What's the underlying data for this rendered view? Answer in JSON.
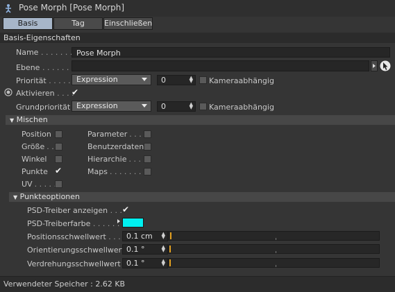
{
  "window": {
    "title": "Pose Morph [Pose Morph]"
  },
  "tabs": [
    {
      "label": "Basis",
      "active": true
    },
    {
      "label": "Tag",
      "active": false
    },
    {
      "label": "Einschließen",
      "active": false
    }
  ],
  "basis": {
    "header": "Basis-Eigenschaften",
    "name_label": "Name",
    "name_dots": ". . . . . . .",
    "name_value": "Pose Morph",
    "ebene_label": "Ebene",
    "ebene_dots": ". . . . . . .",
    "ebene_value": "",
    "prioritaet_label": "Priorität",
    "prioritaet_dots": ". . . . .",
    "prioritaet_dropdown": "Expression",
    "prioritaet_number": "0",
    "kamera_label": "Kameraabhängig",
    "aktivieren_label": "Aktivieren",
    "aktivieren_dots": ". . . .",
    "aktivieren_checked": true,
    "grundprioritaet_label": "Grundpriorität",
    "grundprioritaet_dropdown": "Expression",
    "grundprioritaet_number": "0",
    "grund_kamera_label": "Kameraabhängig"
  },
  "mischen": {
    "header": "Mischen",
    "left": [
      {
        "label": "Position",
        "dots": "",
        "checked": false
      },
      {
        "label": "Größe",
        "dots": ". .",
        "checked": false
      },
      {
        "label": "Winkel",
        "dots": "",
        "checked": false
      },
      {
        "label": "Punkte",
        "dots": "",
        "checked": true
      },
      {
        "label": "UV",
        "dots": ". . . . .",
        "checked": false
      }
    ],
    "right": [
      {
        "label": "Parameter",
        "dots": ". . . .",
        "checked": false
      },
      {
        "label": "Benutzerdaten",
        "dots": "",
        "checked": false
      },
      {
        "label": "Hierarchie",
        "dots": ". . .",
        "checked": false
      },
      {
        "label": "Maps",
        "dots": ". . . . . . . .",
        "checked": false
      }
    ]
  },
  "punkteoptionen": {
    "header": "Punkteoptionen",
    "psd_anzeigen_label": "PSD-Treiber anzeigen",
    "psd_anzeigen_dots": ". . .",
    "psd_anzeigen_checked": true,
    "psd_farbe_label": "PSD-Treiberfarbe",
    "psd_farbe_dots": ". . . . . .",
    "psd_farbe_color": "#00f0f0",
    "positionsschwellwert_label": "Positionsschwellwert",
    "positionsschwellwert_dots": ". . . .",
    "positionsschwellwert_value": "0.1 cm",
    "orientierungsschwellwert_label": "Orientierungsschwellwert",
    "orientierungsschwellwert_value": "0.1 °",
    "verdrehungsschwellwert_label": "Verdrehungsschwellwert",
    "verdrehungsschwellwert_value": "0.1 °"
  },
  "footer": {
    "memory_label": "Verwendeter Speicher :",
    "memory_value": "2.62 KB"
  },
  "colors": {
    "accent_tab": "#a7b6c9",
    "slider_marker": "#e3a020",
    "psd_color": "#00f0f0"
  }
}
